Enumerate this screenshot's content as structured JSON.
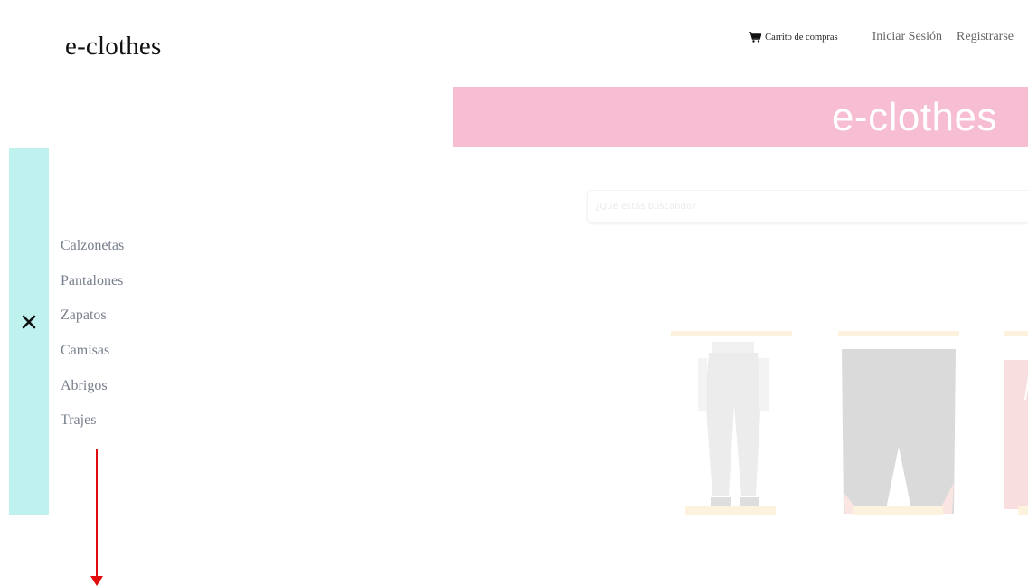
{
  "header": {
    "brand": "e-clothes",
    "cart_label": "Carrito de compras",
    "login_label": "Iniciar Sesión",
    "register_label": "Registrarse",
    "cart_icon": "shopping-cart-icon"
  },
  "banner": {
    "text": "e-clothes",
    "color": "#f6bdd3"
  },
  "search": {
    "placeholder": "¿Qué estás buscando?",
    "value": ""
  },
  "sidebar": {
    "color": "#bff1ef",
    "close_icon": "close-icon",
    "items": [
      {
        "label": "Calzonetas"
      },
      {
        "label": "Pantalones"
      },
      {
        "label": "Zapatos"
      },
      {
        "label": "Camisas"
      },
      {
        "label": "Abrigos"
      },
      {
        "label": "Trajes"
      }
    ]
  },
  "products": [
    {
      "image": "gray-cargo-pants"
    },
    {
      "image": "black-athletic-shorts"
    },
    {
      "image": "red-swim-shorts"
    }
  ],
  "colors": {
    "accent": "#f5a623",
    "annotation": "#e20a0a"
  }
}
